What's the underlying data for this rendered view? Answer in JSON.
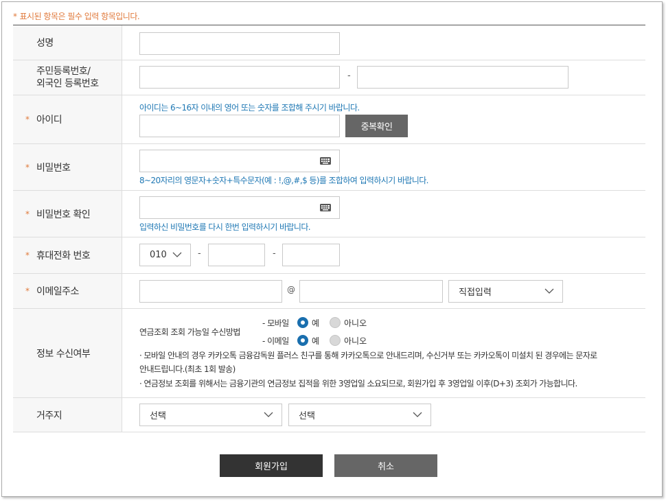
{
  "notice": {
    "star": "*",
    "text": "표시된 항목은 필수 입력 항목입니다."
  },
  "fields": {
    "name": {
      "label": "성명",
      "value": ""
    },
    "resident": {
      "label_line1": "주민등록번호/",
      "label_line2": "외국인 등록번호",
      "sep": "-"
    },
    "userid": {
      "label": "아이디",
      "hint": "아이디는 6~16자 이내의 영어 또는 숫자를 조합해 주시기 바랍니다.",
      "dup_button": "중복확인"
    },
    "password": {
      "label": "비밀번호",
      "hint": "8~20자리의 영문자+숫자+특수문자(예 : !,@,#,$ 등)를 조합하여 입력하시기 바랍니다."
    },
    "password_confirm": {
      "label": "비밀번호 확인",
      "hint": "입력하신 비밀번호를 다시 한번 입력하시기 바랍니다."
    },
    "phone": {
      "label": "휴대전화 번호",
      "prefix": "010",
      "sep": "-"
    },
    "email": {
      "label": "이메일주소",
      "at": "@",
      "domain_select": "직접입력"
    },
    "receive": {
      "label": "정보 수신여부",
      "method_title": "연금조회 조회 가능일 수신방법",
      "mobile_label": "- 모바일",
      "email_label": "- 이메일",
      "yes": "예",
      "no": "아니오",
      "note1_line1": "· 모바일 안내의 경우 카카오톡 금융감독원 플러스 친구를 통해 카카오톡으로 안내드리며, 수신거부 또는 카카오톡이 미설치 된 경우에는 문자로",
      "note1_line2": "안내드립니다.(최초 1회 발송)",
      "note2": "· 연금정보 조회를 위해서는 금융기관의 연금정보 집적을 위한 3영업일 소요되므로, 회원가입 후 3영업일 이후(D+3) 조회가 가능합니다."
    },
    "residence": {
      "label": "거주지",
      "select1": "선택",
      "select2": "선택"
    }
  },
  "required_mark": "*",
  "buttons": {
    "join": "회원가입",
    "cancel": "취소"
  },
  "colors": {
    "accent_orange": "#e07a3c",
    "hint_blue": "#1f78b4",
    "radio_blue": "#1a6fae",
    "join_btn": "#333333",
    "cancel_btn": "#666666"
  }
}
